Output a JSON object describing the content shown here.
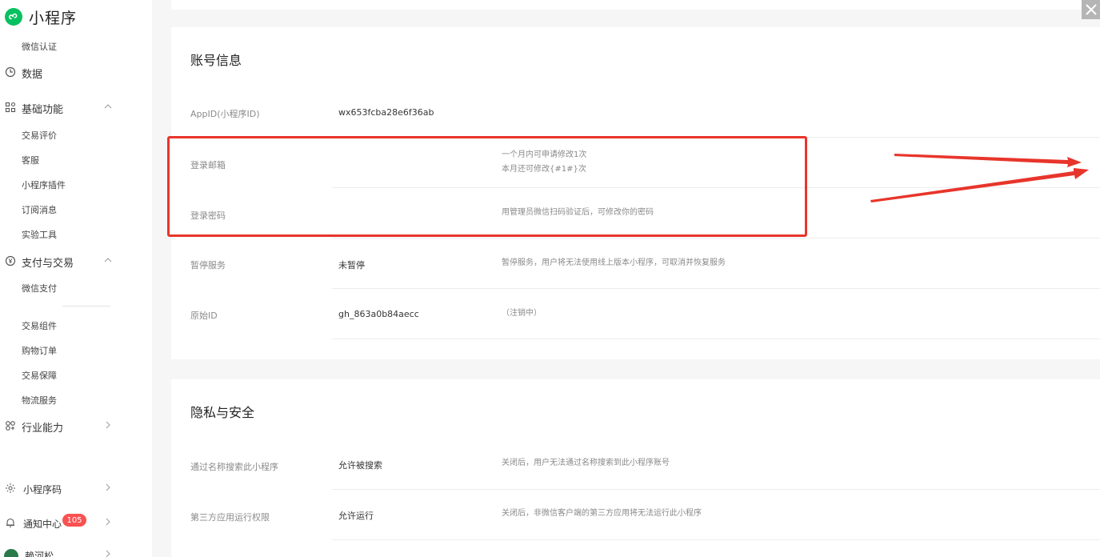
{
  "app": {
    "title": "小程序"
  },
  "sidebar": {
    "wechat_verify": "微信认证",
    "data_label": "数据",
    "basic": {
      "label": "基础功能",
      "items": [
        "交易评价",
        "客服",
        "小程序插件",
        "订阅消息",
        "实验工具"
      ]
    },
    "payment": {
      "label": "支付与交易",
      "items": [
        "微信支付",
        "交易组件",
        "购物订单",
        "交易保障",
        "物流服务"
      ]
    },
    "industry": {
      "label": "行业能力"
    },
    "qrcode": {
      "label": "小程序码"
    },
    "notify": {
      "label": "通知中心",
      "badge": "105"
    },
    "user": {
      "label": "赖河松"
    }
  },
  "account": {
    "title": "账号信息",
    "rows": [
      {
        "label": "AppID(小程序ID)",
        "value": "wx653fcba28e6f36ab",
        "desc": ""
      },
      {
        "label": "登录邮箱",
        "value": "",
        "desc": "一个月内可申请修改1次",
        "desc2": "本月还可修改{#1#}次"
      },
      {
        "label": "登录密码",
        "value": "",
        "desc": "用管理员微信扫码验证后，可修改你的密码"
      },
      {
        "label": "暂停服务",
        "value": "未暂停",
        "desc": "暂停服务，用户将无法使用线上版本小程序，可取消并恢复服务"
      },
      {
        "label": "原始ID",
        "value": "gh_863a0b84aecc",
        "desc": "（注销中）"
      }
    ]
  },
  "privacy": {
    "title": "隐私与安全",
    "rows": [
      {
        "label": "通过名称搜索此小程序",
        "value": "允许被搜索",
        "desc": "关闭后，用户无法通过名称搜索到此小程序账号"
      },
      {
        "label": "第三方应用运行权限",
        "value": "允许运行",
        "desc": "关闭后，非微信客户端的第三方应用将无法运行此小程序"
      }
    ]
  },
  "colors": {
    "brand": "#07c160",
    "highlight": "#e8352b",
    "badge": "#fa5151"
  }
}
